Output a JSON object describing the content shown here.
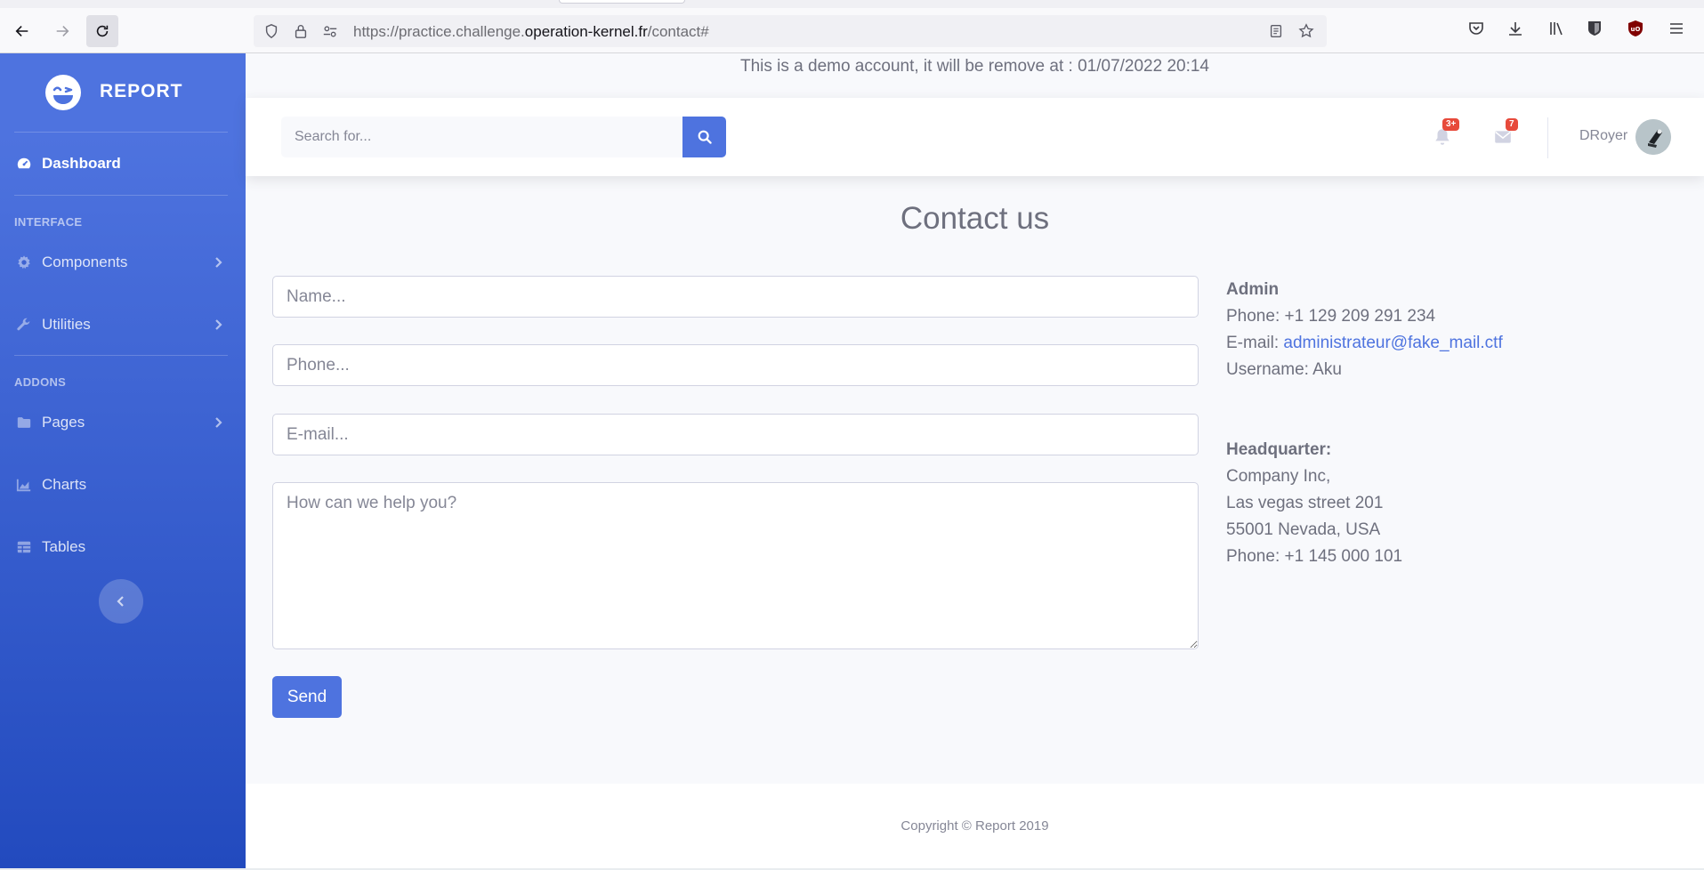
{
  "browser": {
    "url_prefix": "https://practice.challenge.",
    "url_host": "operation-kernel.fr",
    "url_path": "/contact#"
  },
  "sidebar": {
    "brand": "REPORT",
    "dashboard": "Dashboard",
    "heading_interface": "Interface",
    "components": "Components",
    "utilities": "Utilities",
    "heading_addons": "Addons",
    "pages": "Pages",
    "charts": "Charts",
    "tables": "Tables"
  },
  "notice": "This is a demo account, it will be remove at : 01/07/2022 20:14",
  "topbar": {
    "search_placeholder": "Search for...",
    "alerts_badge": "3+",
    "messages_badge": "7",
    "user_name": "DRoyer"
  },
  "page": {
    "title": "Contact us",
    "name_placeholder": "Name...",
    "phone_placeholder": "Phone...",
    "email_placeholder": "E-mail...",
    "message_placeholder": "How can we help you?",
    "send_label": "Send"
  },
  "contact": {
    "admin_heading": "Admin",
    "admin_phone": "Phone: +1 129 209 291 234",
    "admin_email_label": "E-mail: ",
    "admin_email": "administrateur@fake_mail.ctf",
    "admin_username": "Username: Aku",
    "hq_heading": "Headquarter:",
    "hq_company": "Company Inc,",
    "hq_street": "Las vegas street 201",
    "hq_city": "55001 Nevada, USA",
    "hq_phone": "Phone: +1 145 000 101"
  },
  "footer": {
    "copyright": "Copyright © Report 2019"
  },
  "colors": {
    "primary": "#4e73df",
    "sidebar_bottom": "#224abe",
    "badge": "#e74a3b"
  }
}
